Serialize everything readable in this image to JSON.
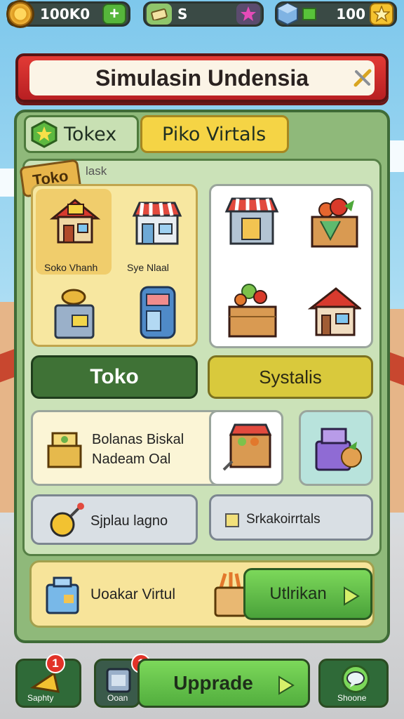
{
  "topbar": {
    "coins": "100K0",
    "currency2": "S",
    "gems": "100"
  },
  "title": "Simulasin Undensia",
  "tabs": [
    {
      "label": "To‍k‍e‍x"
    },
    {
      "label": "Piko Virtals"
    }
  ],
  "section": {
    "ribbon": "Toko",
    "label": "lask"
  },
  "shops": [
    {
      "label": "Soko Vhanh"
    },
    {
      "label": "Sye Nlaal"
    }
  ],
  "buttons": {
    "toko": "Toko",
    "systalis": "Systalis"
  },
  "balance": {
    "line1": "Bolanas Biskal",
    "line2": "Nadeam Oal"
  },
  "options": {
    "left": "Sjplau lagno",
    "right": "Srkakoirrtals"
  },
  "footer": {
    "label": "Uoakar Virtul",
    "button": "Utlrikan"
  },
  "bottom_nav": {
    "left": "Saphty",
    "left_badge": "1",
    "mid_small": "Ooan",
    "mid_badge": "1",
    "upgrade": "Upprade",
    "right": "Shoone"
  },
  "colors": {
    "title_red": "#d22a2a",
    "panel_green": "#8fb97a",
    "tab_yellow": "#f5d445",
    "toko_green": "#3f7236",
    "systalis_yellow": "#d9c93c",
    "upgrade_green": "#62c24a"
  }
}
